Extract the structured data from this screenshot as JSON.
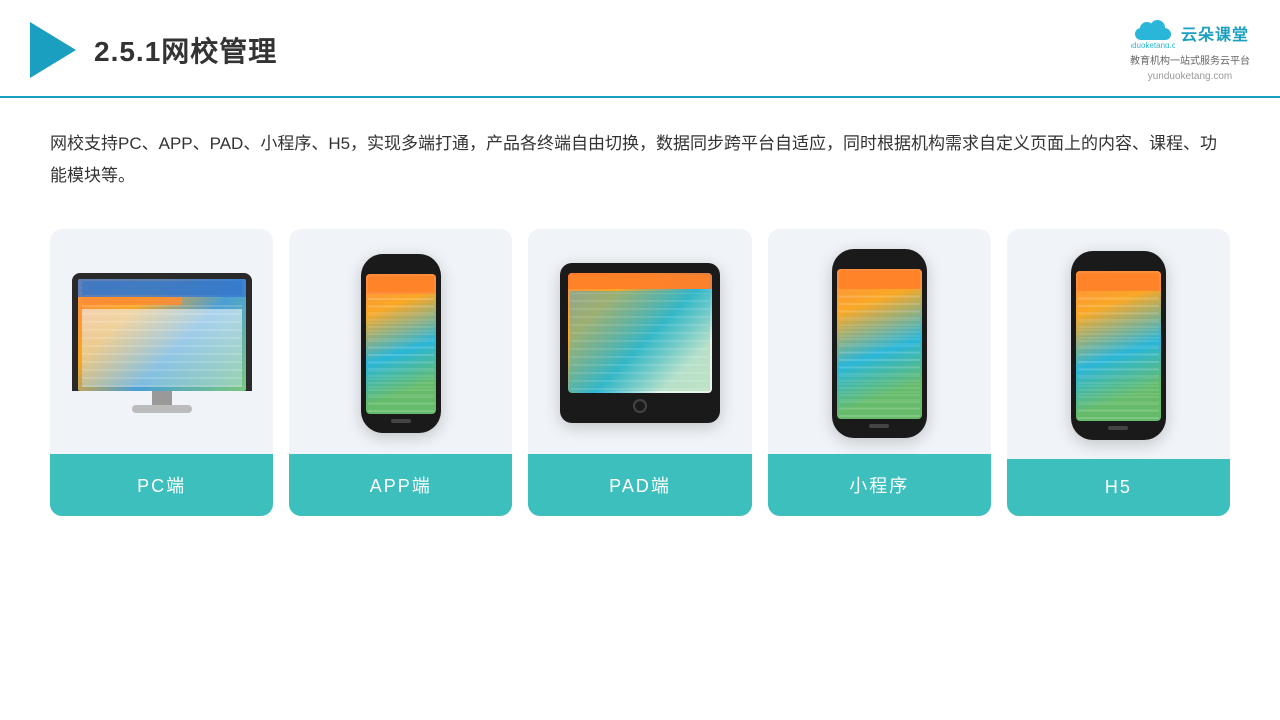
{
  "header": {
    "title": "2.5.1网校管理",
    "brand_name": "云朵课堂",
    "brand_url": "yunduoketang.com",
    "brand_tagline": "教育机构一站\n式服务云平台"
  },
  "description": "网校支持PC、APP、PAD、小程序、H5，实现多端打通，产品各终端自由切换，数据同步跨平台自适应，同时根据机构需求自定义页面上的内容、课程、功能模块等。",
  "cards": [
    {
      "id": "pc",
      "label": "PC端"
    },
    {
      "id": "app",
      "label": "APP端"
    },
    {
      "id": "pad",
      "label": "PAD端"
    },
    {
      "id": "miniprogram",
      "label": "小程序"
    },
    {
      "id": "h5",
      "label": "H5"
    }
  ]
}
